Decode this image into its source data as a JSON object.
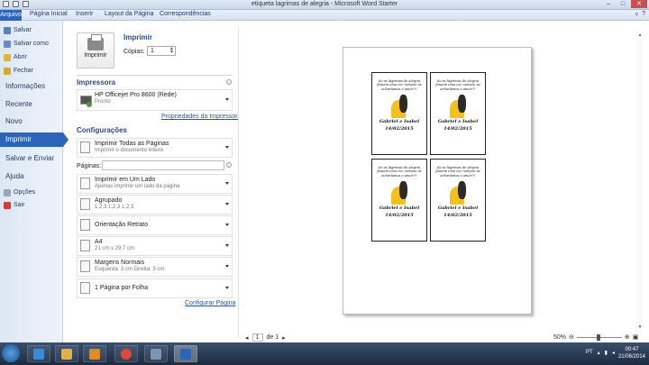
{
  "window": {
    "title": "etiqueta lagrimas de alegria - Microsoft Word Starter"
  },
  "ribbon": {
    "tabs": [
      "Arquivo",
      "Página Inicial",
      "Inserir",
      "Layout da Página",
      "Correspondências"
    ]
  },
  "nav": {
    "small_items": [
      "Salvar",
      "Salvar como",
      "Abrir",
      "Fechar"
    ],
    "big_items": [
      "Informações",
      "Recente",
      "Novo",
      "Imprimir",
      "Salvar e Enviar",
      "Ajuda"
    ],
    "bottom_items": [
      "Opções",
      "Sair"
    ]
  },
  "print": {
    "section_title": "Imprimir",
    "button_label": "Imprimir",
    "copies_label": "Cópias:",
    "copies_value": "1",
    "printer_title": "Impressora",
    "printer_name": "HP Officejet Pro 8600 (Rede)",
    "printer_status": "Pronto",
    "printer_props_link": "Propriedades da Impressora",
    "settings_title": "Configurações",
    "pages_label": "Páginas:",
    "pages_value": "",
    "config_link": "Configurar Página",
    "settings": [
      {
        "line1": "Imprimir Todas as Páginas",
        "line2": "Imprimir o documento inteiro"
      },
      {
        "line1": "Imprimir em Um Lado",
        "line2": "Apenas imprimir um lado da página"
      },
      {
        "line1": "Agrupado",
        "line2": "1,2,3    1,2,3    1,2,3"
      },
      {
        "line1": "Orientação Retrato",
        "line2": ""
      },
      {
        "line1": "A4",
        "line2": "21 cm x 29,7 cm"
      },
      {
        "line1": "Margens Normais",
        "line2": "Esquerda: 3 cm    Direita: 3 cm"
      },
      {
        "line1": "1 Página por Folha",
        "line2": ""
      }
    ]
  },
  "preview": {
    "labels": [
      {
        "caption": "Se as lágrimas de alegria fossem uma cor, sempre as acharíamos o amor!!!",
        "names": "Gabriel e Isabel",
        "date": "14/02/2015"
      },
      {
        "caption": "Se as lágrimas de alegria fossem uma cor, sempre as acharíamos o amor!!!",
        "names": "Gabriel e Isabel",
        "date": "14/02/2015"
      },
      {
        "caption": "Se as lágrimas de alegria fossem uma cor, sempre as acharíamos o amor!!!",
        "names": "Gabriel e Isabel",
        "date": "14/02/2015"
      },
      {
        "caption": "Se as lágrimas de alegria fossem uma cor, sempre as acharíamos o amor!!!",
        "names": "Gabriel e Isabel",
        "date": "14/02/2015"
      }
    ],
    "page_current": "1",
    "page_of": "de 1",
    "zoom": "50%"
  },
  "taskbar": {
    "lang": "PT",
    "time": "00:47",
    "date": "21/06/2014"
  },
  "colors": {
    "accent": "#2b64b8",
    "nav_bg": "#dde8f5"
  }
}
